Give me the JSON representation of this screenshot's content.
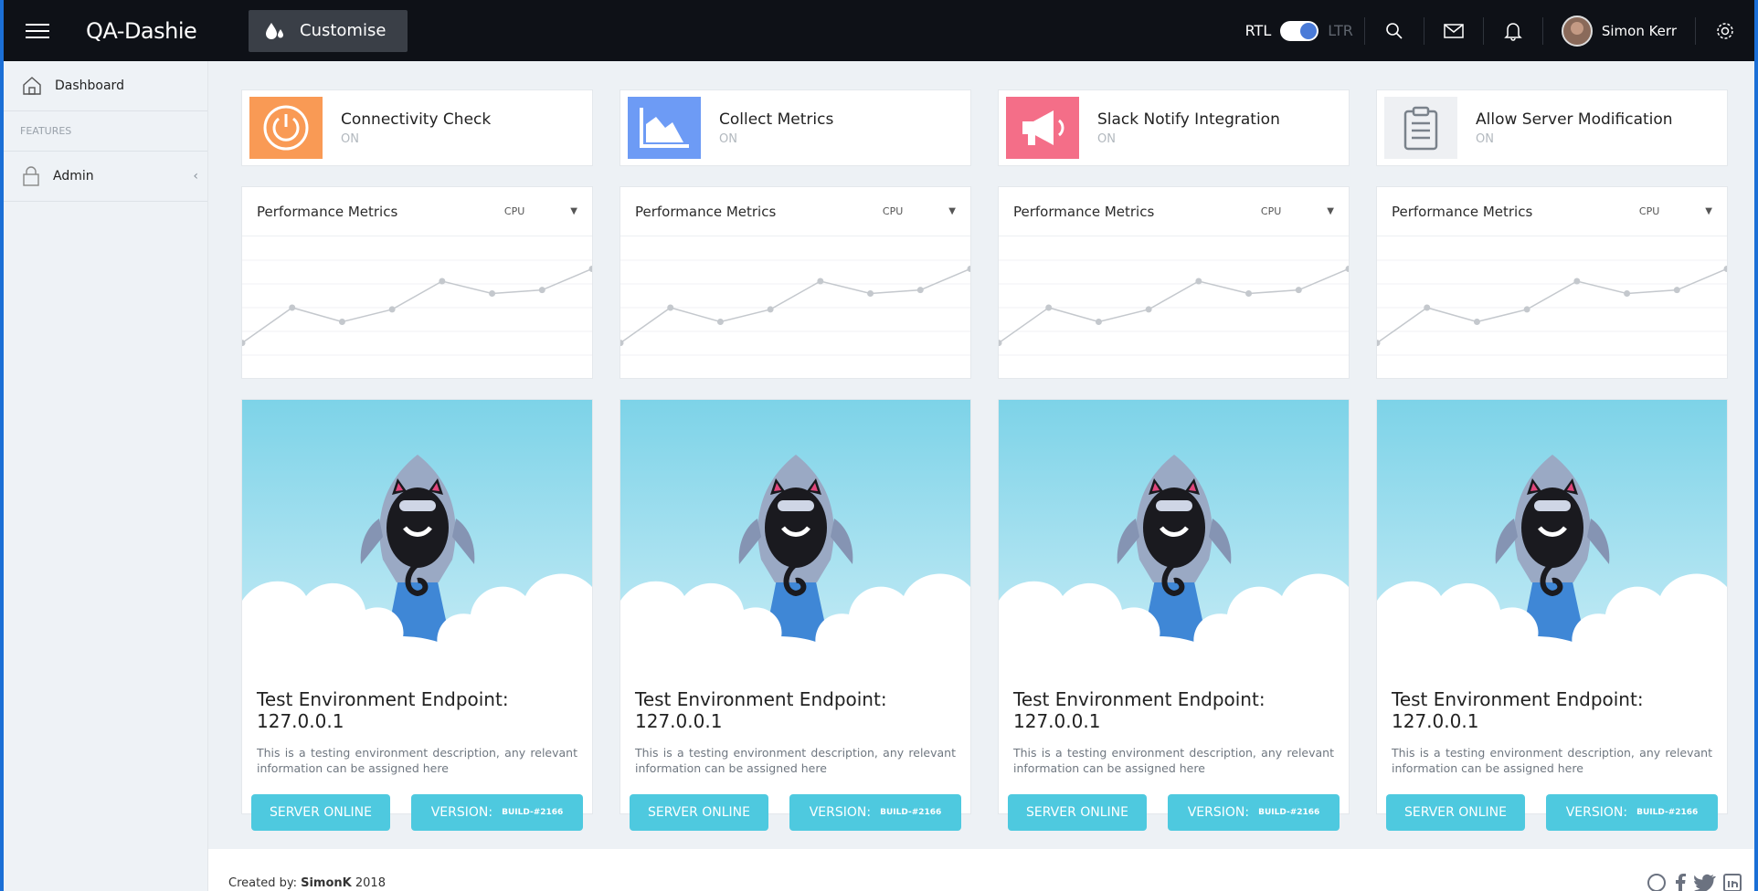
{
  "header": {
    "brand": "QA-Dashie",
    "customise_label": "Customise",
    "rtl_label": "RTL",
    "ltr_label": "LTR",
    "user_name": "Simon Kerr"
  },
  "sidebar": {
    "items": [
      {
        "label": "Dashboard"
      },
      {
        "label": "Admin"
      }
    ],
    "section_heading": "FEATURES"
  },
  "features": [
    {
      "title": "Connectivity Check",
      "status": "ON",
      "icon": "power-icon",
      "color": "#f99a55"
    },
    {
      "title": "Collect Metrics",
      "status": "ON",
      "icon": "area-chart-icon",
      "color": "#6d9bf5"
    },
    {
      "title": "Slack Notify Integration",
      "status": "ON",
      "icon": "megaphone-icon",
      "color": "#f46e88"
    },
    {
      "title": "Allow Server Modification",
      "status": "ON",
      "icon": "clipboard-icon",
      "color": "#eef0f3"
    }
  ],
  "performance": {
    "title": "Performance Metrics",
    "metric": "CPU"
  },
  "environments": {
    "title": "Test Environment Endpoint: 127.0.0.1",
    "description": "This is a testing environment description, any relevant information can be assigned here",
    "status_button": "SERVER ONLINE",
    "version_label": "VERSION:",
    "version_value": "BUILD-#2166"
  },
  "footer": {
    "created_by": "Created by:",
    "author": "SimonK",
    "year": "2018"
  },
  "chart_data": {
    "type": "line",
    "series": [
      {
        "values": [
          10,
          30,
          22,
          29,
          45,
          38,
          40,
          52
        ]
      }
    ],
    "xlabel": "",
    "ylabel": ""
  }
}
